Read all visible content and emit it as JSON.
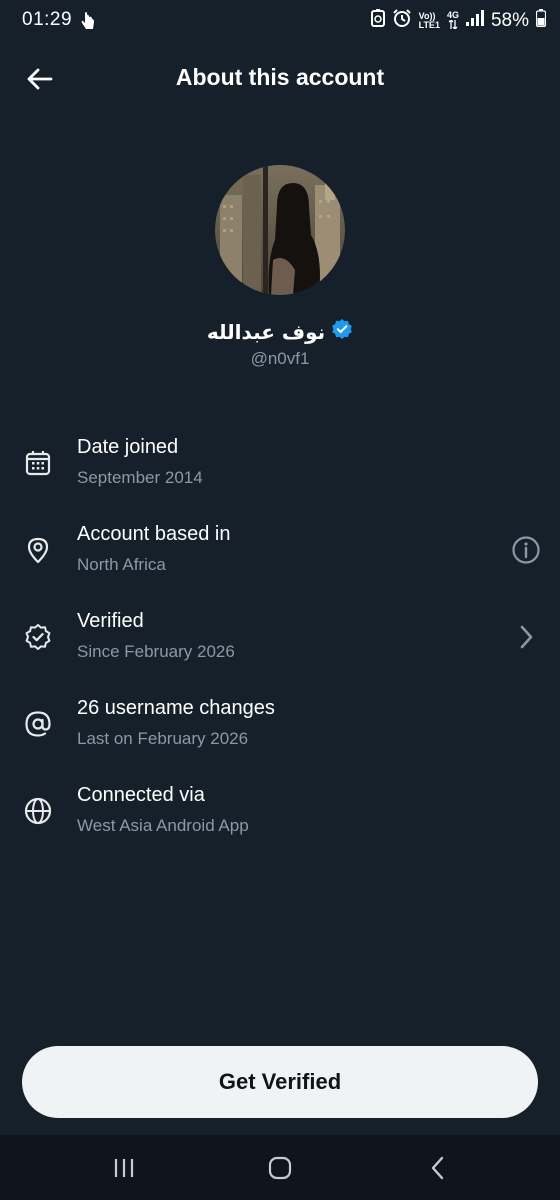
{
  "status_bar": {
    "time": "01:29",
    "volte_top": "Vo))",
    "volte_bottom": "LTE1",
    "network_type": "4G",
    "battery": "58%"
  },
  "header": {
    "title": "About this account"
  },
  "profile": {
    "display_name": "نوف عبدالله",
    "username": "@n0vf1",
    "verified_badge_color": "#1d9bf0"
  },
  "info": [
    {
      "icon": "calendar-icon",
      "title": "Date joined",
      "subtitle": "September 2014"
    },
    {
      "icon": "location-pin-icon",
      "title": "Account based in",
      "subtitle": "North Africa",
      "action": "info-icon"
    },
    {
      "icon": "verified-seal-icon",
      "title": "Verified",
      "subtitle": "Since February 2026",
      "action": "chevron-right-icon"
    },
    {
      "icon": "at-sign-icon",
      "title": "26 username changes",
      "subtitle": "Last on February 2026"
    },
    {
      "icon": "globe-icon",
      "title": "Connected via",
      "subtitle": "West Asia Android App"
    }
  ],
  "button": {
    "label": "Get Verified"
  },
  "colors": {
    "background": "#15202b",
    "secondary_text": "#8b98a5",
    "button_bg": "#eff3f4"
  }
}
